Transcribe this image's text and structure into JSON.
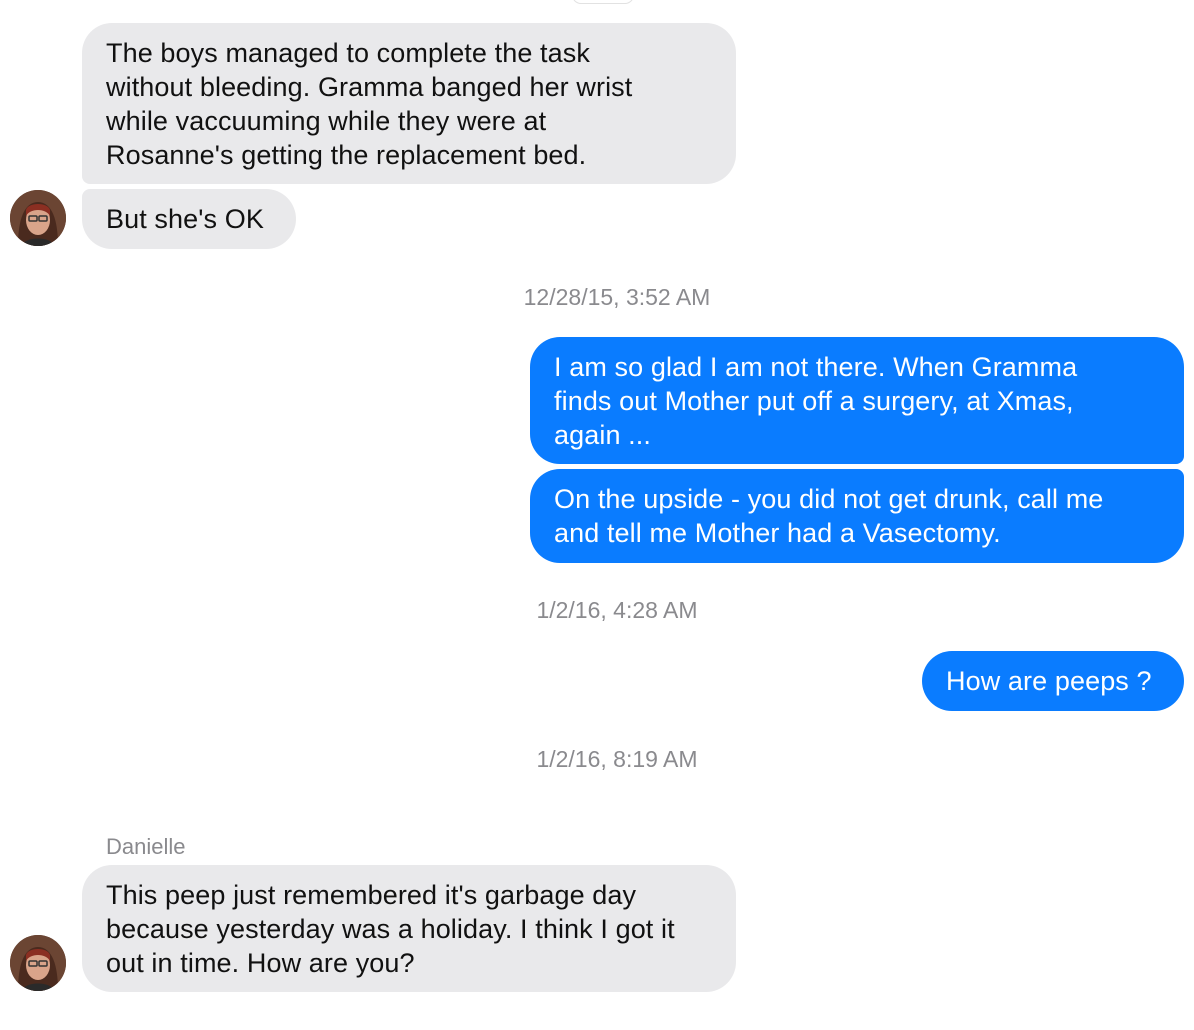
{
  "contact": {
    "name": "Danielle"
  },
  "messages": {
    "m1": "The boys managed to complete the task\nwithout bleeding. Gramma banged her wrist\nwhile vaccuuming while they were at\nRosanne's getting the replacement bed.",
    "m2": "But she's OK",
    "ts1": "12/28/15, 3:52 AM",
    "m3": "I am so glad I am not there.  When Gramma\nfinds out Mother put off a surgery, at Xmas,\nagain ...",
    "m4": "On the upside - you did not get drunk, call me\nand tell me Mother had a Vasectomy.",
    "ts2": "1/2/16, 4:28 AM",
    "m5": "How are peeps ?",
    "ts3": "1/2/16, 8:19 AM",
    "m6": "This peep just remembered it's garbage day\nbecause yesterday was a holiday. I think I got it\nout in time. How are you?"
  },
  "colors": {
    "incoming_bubble": "#e9e9eb",
    "outgoing_bubble": "#0a7cff",
    "timestamp_text": "#8a8a8e"
  },
  "icons": {
    "avatar": "contact-avatar"
  }
}
